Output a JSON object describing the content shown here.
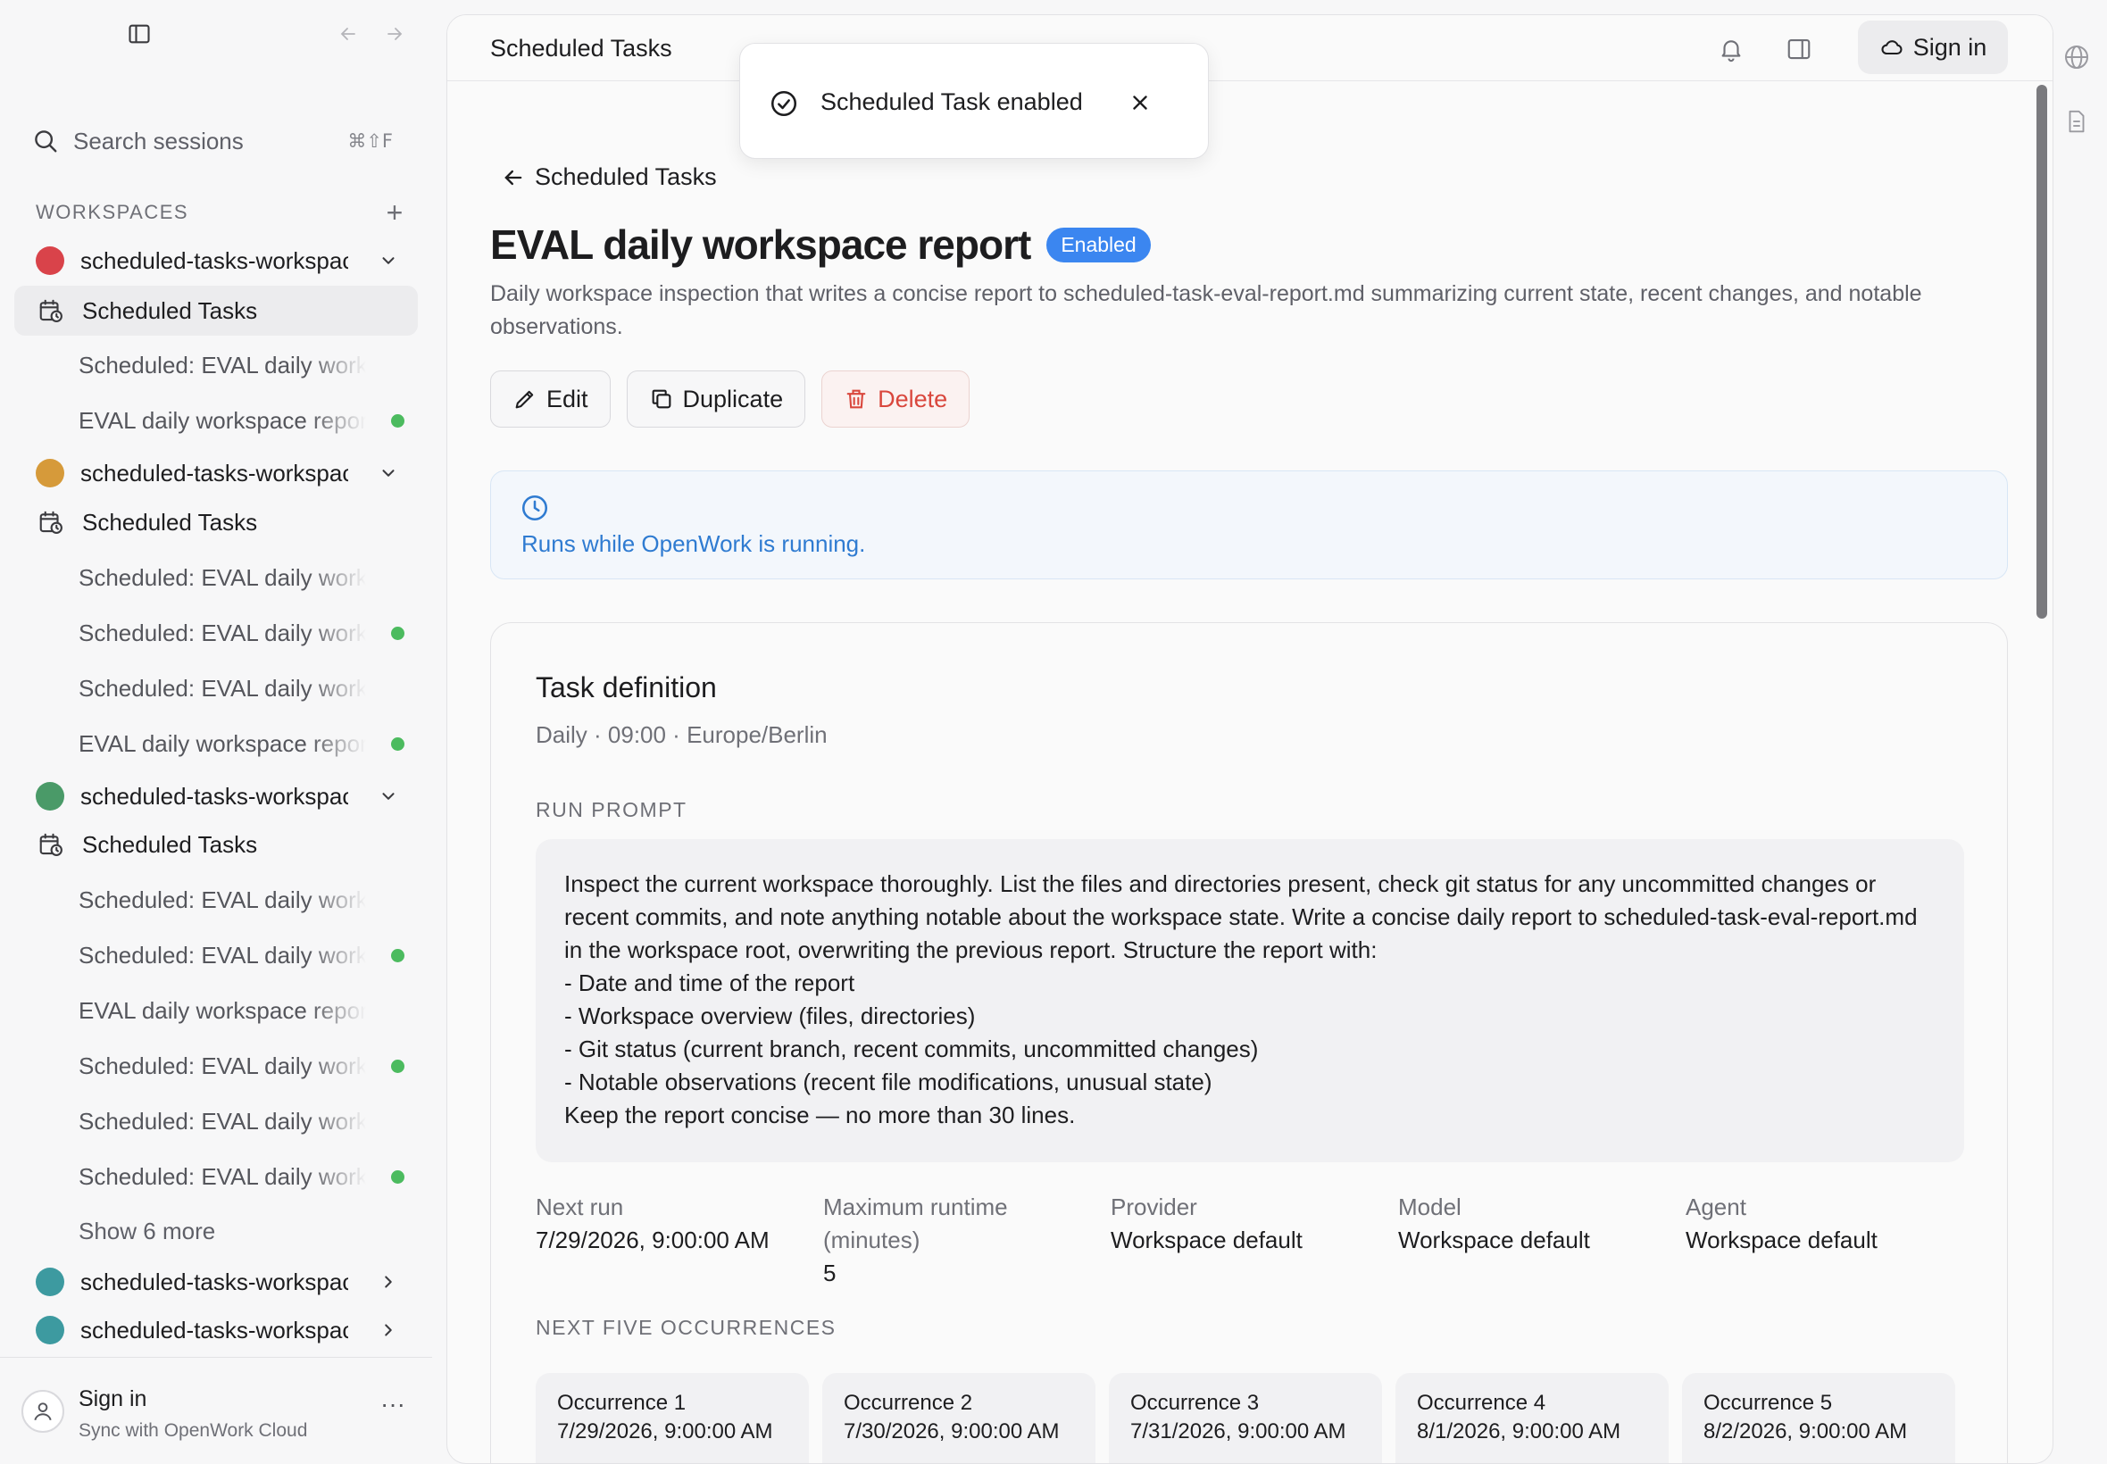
{
  "sidebar": {
    "search": {
      "label": "Search sessions",
      "shortcut": "⌘⇧F"
    },
    "workspaces_label": "WORKSPACES",
    "items": [
      {
        "kind": "workspace",
        "label": "scheduled-tasks-workspace",
        "color": "#d9434a",
        "chevron": "down"
      },
      {
        "kind": "tasks",
        "label": "Scheduled Tasks",
        "active": true
      },
      {
        "kind": "session",
        "label": "Scheduled: EVAL daily workspace report",
        "status": false
      },
      {
        "kind": "session",
        "label": "EVAL daily workspace report",
        "status": true
      },
      {
        "kind": "workspace",
        "label": "scheduled-tasks-workspace",
        "color": "#d69a3a",
        "chevron": "down"
      },
      {
        "kind": "tasks",
        "label": "Scheduled Tasks"
      },
      {
        "kind": "session",
        "label": "Scheduled: EVAL daily workspace report",
        "status": false
      },
      {
        "kind": "session",
        "label": "Scheduled: EVAL daily workspace report",
        "status": true
      },
      {
        "kind": "session",
        "label": "Scheduled: EVAL daily workspace report",
        "status": false
      },
      {
        "kind": "session",
        "label": "EVAL daily workspace report",
        "status": true
      },
      {
        "kind": "workspace",
        "label": "scheduled-tasks-workspace",
        "color": "#4a9a68",
        "chevron": "down"
      },
      {
        "kind": "tasks",
        "label": "Scheduled Tasks"
      },
      {
        "kind": "session",
        "label": "Scheduled: EVAL daily workspace report",
        "status": false
      },
      {
        "kind": "session",
        "label": "Scheduled: EVAL daily workspace report",
        "status": true
      },
      {
        "kind": "session",
        "label": "EVAL daily workspace report",
        "status": false
      },
      {
        "kind": "session",
        "label": "Scheduled: EVAL daily workspace report",
        "status": true
      },
      {
        "kind": "session",
        "label": "Scheduled: EVAL daily workspace report",
        "status": false
      },
      {
        "kind": "session",
        "label": "Scheduled: EVAL daily workspace report",
        "status": true
      },
      {
        "kind": "more",
        "label": "Show 6 more"
      },
      {
        "kind": "workspace",
        "label": "scheduled-tasks-workspace",
        "color": "#3d9aa0",
        "chevron": "right"
      },
      {
        "kind": "workspace",
        "label": "scheduled-tasks-workspace",
        "color": "#3d9aa0",
        "chevron": "right"
      }
    ],
    "footer": {
      "title": "Sign in",
      "subtitle": "Sync with OpenWork Cloud"
    }
  },
  "topbar": {
    "title": "Scheduled Tasks",
    "signin_label": "Sign in"
  },
  "toast": {
    "message": "Scheduled Task enabled"
  },
  "page": {
    "back_label": "Scheduled Tasks",
    "title": "EVAL daily workspace report",
    "status_badge": "Enabled",
    "description": "Daily workspace inspection that writes a concise report to scheduled-task-eval-report.md summarizing current state, recent changes, and notable observations.",
    "actions": {
      "edit": "Edit",
      "duplicate": "Duplicate",
      "delete": "Delete"
    },
    "info": "Runs while OpenWork is running."
  },
  "task_definition": {
    "title": "Task definition",
    "schedule": "Daily · 09:00 · Europe/Berlin",
    "run_prompt_label": "RUN PROMPT",
    "run_prompt": "Inspect the current workspace thoroughly. List the files and directories present, check git status for any uncommitted changes or recent commits, and note anything notable about the workspace state. Write a concise daily report to scheduled-task-eval-report.md in the workspace root, overwriting the previous report. Structure the report with:\n- Date and time of the report\n- Workspace overview (files, directories)\n- Git status (current branch, recent commits, uncommitted changes)\n- Notable observations (recent file modifications, unusual state)\nKeep the report concise — no more than 30 lines.",
    "fields": [
      {
        "label": "Next run",
        "value": "7/29/2026, 9:00:00 AM"
      },
      {
        "label": "Maximum runtime (minutes)",
        "value": "5"
      },
      {
        "label": "Provider",
        "value": "Workspace default"
      },
      {
        "label": "Model",
        "value": "Workspace default"
      },
      {
        "label": "Agent",
        "value": "Workspace default"
      }
    ],
    "occurrences_label": "NEXT FIVE OCCURRENCES",
    "occurrences": [
      {
        "label": "Occurrence 1",
        "value": "7/29/2026, 9:00:00 AM"
      },
      {
        "label": "Occurrence 2",
        "value": "7/30/2026, 9:00:00 AM"
      },
      {
        "label": "Occurrence 3",
        "value": "7/31/2026, 9:00:00 AM"
      },
      {
        "label": "Occurrence 4",
        "value": "8/1/2026, 9:00:00 AM"
      },
      {
        "label": "Occurrence 5",
        "value": "8/2/2026, 9:00:00 AM"
      }
    ]
  }
}
